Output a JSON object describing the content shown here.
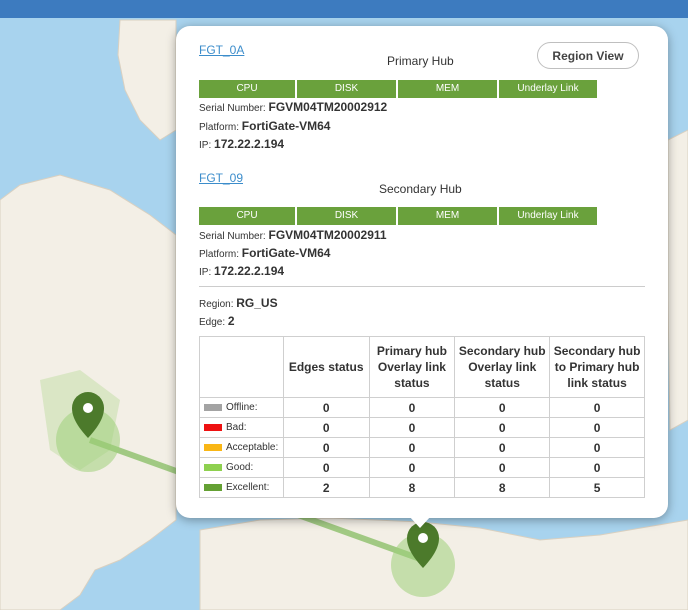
{
  "colors": {
    "offline": "#a3a3a3",
    "bad": "#ee1111",
    "acceptable": "#f9b615",
    "good": "#8ed04f",
    "excellent": "#64a033",
    "status_bar": "#6aa13c",
    "link": "#3c8dcb"
  },
  "primary": {
    "link": "FGT_0A",
    "role": "Primary Hub",
    "bars": [
      "CPU",
      "DISK",
      "MEM",
      "Underlay Link"
    ],
    "serial_label": "Serial Number:",
    "serial": "FGVM04TM20002912",
    "platform_label": "Platform:",
    "platform": "FortiGate-VM64",
    "ip_label": "IP:",
    "ip": "172.22.2.194"
  },
  "secondary": {
    "link": "FGT_09",
    "role": "Secondary Hub",
    "bars": [
      "CPU",
      "DISK",
      "MEM",
      "Underlay Link"
    ],
    "serial_label": "Serial Number:",
    "serial": "FGVM04TM20002911",
    "platform_label": "Platform:",
    "platform": "FortiGate-VM64",
    "ip_label": "IP:",
    "ip": "172.22.2.194"
  },
  "region_button": "Region View",
  "region": {
    "label": "Region:",
    "value": "RG_US"
  },
  "edge": {
    "label": "Edge:",
    "value": "2"
  },
  "table": {
    "headers": [
      "",
      "Edges status",
      "Primary hub Overlay link status",
      "Secondary hub Overlay link status",
      "Secondary hub to Primary hub link status"
    ],
    "rows": [
      {
        "label": "Offline:",
        "color": "#a3a3a3",
        "values": [
          "0",
          "0",
          "0",
          "0"
        ]
      },
      {
        "label": "Bad:",
        "color": "#ee1111",
        "values": [
          "0",
          "0",
          "0",
          "0"
        ]
      },
      {
        "label": "Acceptable:",
        "color": "#f9b615",
        "values": [
          "0",
          "0",
          "0",
          "0"
        ]
      },
      {
        "label": "Good:",
        "color": "#8ed04f",
        "values": [
          "0",
          "0",
          "0",
          "0"
        ]
      },
      {
        "label": "Excellent:",
        "color": "#64a033",
        "values": [
          "2",
          "8",
          "8",
          "5"
        ]
      }
    ]
  },
  "map": {
    "markers": [
      {
        "name": "edge-marker",
        "icon": "network-node-icon"
      },
      {
        "name": "hub-marker",
        "icon": "network-node-icon"
      }
    ]
  }
}
